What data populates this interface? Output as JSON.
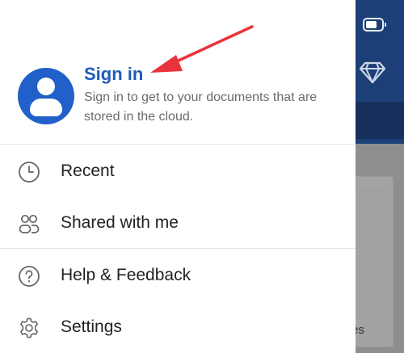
{
  "signin": {
    "title": "Sign in",
    "description": "Sign in to get to your documents that are stored in the cloud."
  },
  "menu": [
    {
      "label": "Recent",
      "icon": "clock-icon"
    },
    {
      "label": "Shared with me",
      "icon": "people-icon"
    },
    {
      "label": "Help & Feedback",
      "icon": "help-icon"
    },
    {
      "label": "Settings",
      "icon": "gear-icon"
    }
  ],
  "background": {
    "partial_text": "es"
  },
  "colors": {
    "accent": "#1f5bb8",
    "avatar": "#2060c8",
    "annotation_arrow": "#e8343a",
    "header_background": "#1d3f78"
  }
}
